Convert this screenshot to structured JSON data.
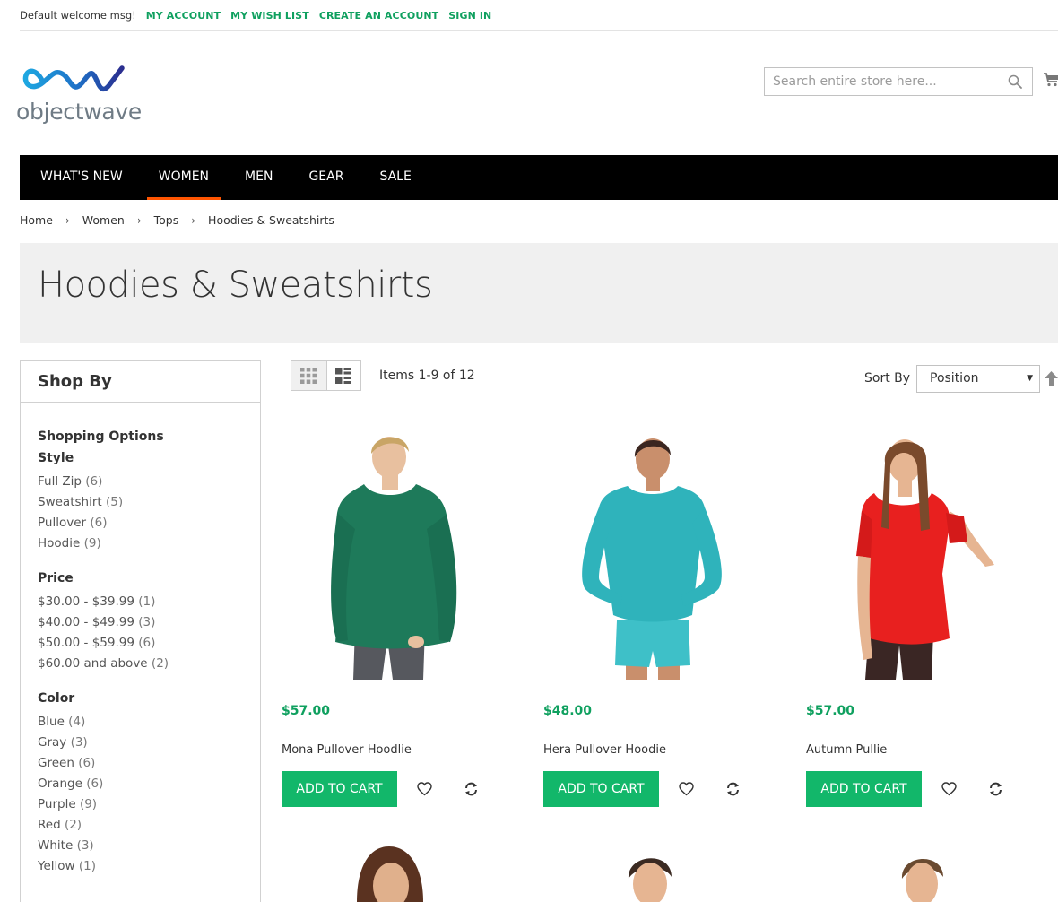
{
  "topbar": {
    "welcome": "Default welcome msg!",
    "links": [
      "MY ACCOUNT",
      "MY WISH LIST",
      "CREATE AN ACCOUNT",
      "SIGN IN"
    ]
  },
  "brand": {
    "name": "objectwave"
  },
  "search": {
    "placeholder": "Search entire store here..."
  },
  "nav": [
    {
      "label": "WHAT'S NEW"
    },
    {
      "label": "WOMEN",
      "active": true
    },
    {
      "label": "MEN"
    },
    {
      "label": "GEAR"
    },
    {
      "label": "SALE"
    }
  ],
  "breadcrumb": [
    "Home",
    "Women",
    "Tops",
    "Hoodies & Sweatshirts"
  ],
  "page_title": "Hoodies & Sweatshirts",
  "sidebar": {
    "title": "Shop By",
    "subtitle": "Shopping Options",
    "groups": [
      {
        "title": "Style",
        "items": [
          {
            "label": "Full Zip",
            "count": "(6)"
          },
          {
            "label": "Sweatshirt",
            "count": "(5)"
          },
          {
            "label": "Pullover",
            "count": "(6)"
          },
          {
            "label": "Hoodie",
            "count": "(9)"
          }
        ]
      },
      {
        "title": "Price",
        "items": [
          {
            "label": "$30.00 - $39.99",
            "count": "(1)"
          },
          {
            "label": "$40.00 - $49.99",
            "count": "(3)"
          },
          {
            "label": "$50.00 - $59.99",
            "count": "(6)"
          },
          {
            "label": "$60.00 and above",
            "count": "(2)"
          }
        ]
      },
      {
        "title": "Color",
        "items": [
          {
            "label": "Blue",
            "count": "(4)"
          },
          {
            "label": "Gray",
            "count": "(3)"
          },
          {
            "label": "Green",
            "count": "(6)"
          },
          {
            "label": "Orange",
            "count": "(6)"
          },
          {
            "label": "Purple",
            "count": "(9)"
          },
          {
            "label": "Red",
            "count": "(2)"
          },
          {
            "label": "White",
            "count": "(3)"
          },
          {
            "label": "Yellow",
            "count": "(1)"
          }
        ]
      }
    ]
  },
  "toolbar": {
    "amount": "Items 1-9 of 12",
    "sort_label": "Sort By",
    "sort_value": "Position"
  },
  "products": [
    {
      "name": "Mona Pullover Hoodlie",
      "price": "$57.00",
      "button": "ADD TO CART",
      "shirt_color": "#1e7a5a"
    },
    {
      "name": "Hera Pullover Hoodie",
      "price": "$48.00",
      "button": "ADD TO CART",
      "shirt_color": "#2fb3bb"
    },
    {
      "name": "Autumn Pullie",
      "price": "$57.00",
      "button": "ADD TO CART",
      "shirt_color": "#e8201f"
    }
  ],
  "colors": {
    "accent": "#0fa05f",
    "button": "#12b76a",
    "nav_bg": "#000000",
    "nav_active": "#ff5501"
  }
}
